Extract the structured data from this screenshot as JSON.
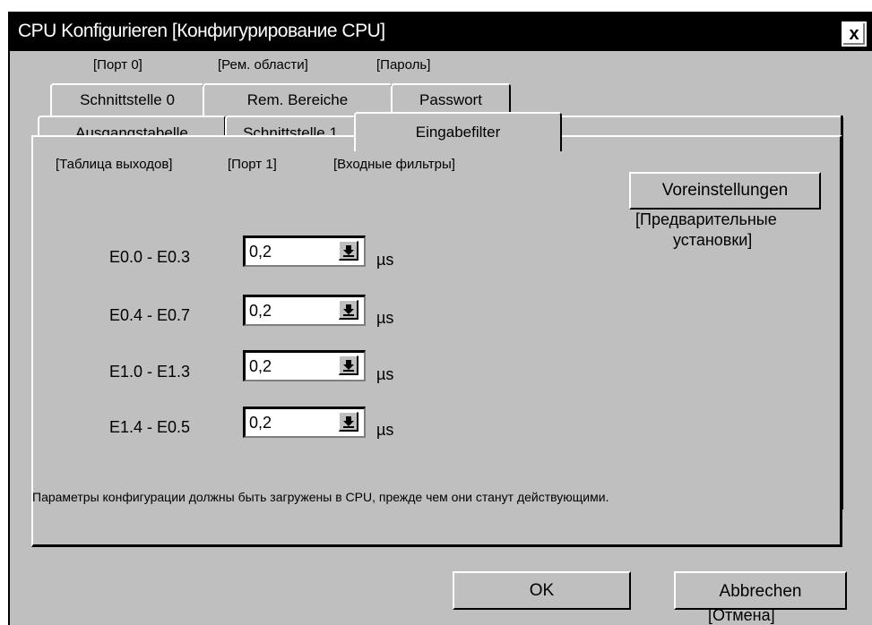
{
  "dialog": {
    "title": "CPU Konfigurieren [Конфигурирование CPU]",
    "close_label": "x"
  },
  "tabs_top": [
    {
      "label": "Schnittstelle 0",
      "translation": "[Порт 0]"
    },
    {
      "label": "Rem. Bereiche",
      "translation": "[Рем. области]"
    },
    {
      "label": "Passwort",
      "translation": "[Пароль]"
    }
  ],
  "tabs_bottom": [
    {
      "label": "Ausgangstabelle",
      "translation": "[Таблица выходов]"
    },
    {
      "label": "Schnittstelle 1",
      "translation": "[Порт 1]"
    },
    {
      "label": "Eingabefilter",
      "translation": "[Входные фильтры]",
      "active": true
    }
  ],
  "presets": {
    "button_label": "Voreinstellungen",
    "translation_line1": "[Предварительные",
    "translation_line2": "установки]"
  },
  "filters": [
    {
      "range": "E0.0 - E0.3",
      "value": "0,2",
      "unit": "µs"
    },
    {
      "range": "E0.4 - E0.7",
      "value": "0,2",
      "unit": "µs"
    },
    {
      "range": "E1.0 - E1.3",
      "value": "0,2",
      "unit": "µs"
    },
    {
      "range": "E1.4 - E0.5",
      "value": "0,2",
      "unit": "µs"
    }
  ],
  "note": "Параметры конфигурации должны быть загружены в  CPU, прежде чем они станут действующими.",
  "footer": {
    "ok_label": "OK",
    "cancel_label": "Abbrechen",
    "cancel_translation": "[Отмена]"
  }
}
